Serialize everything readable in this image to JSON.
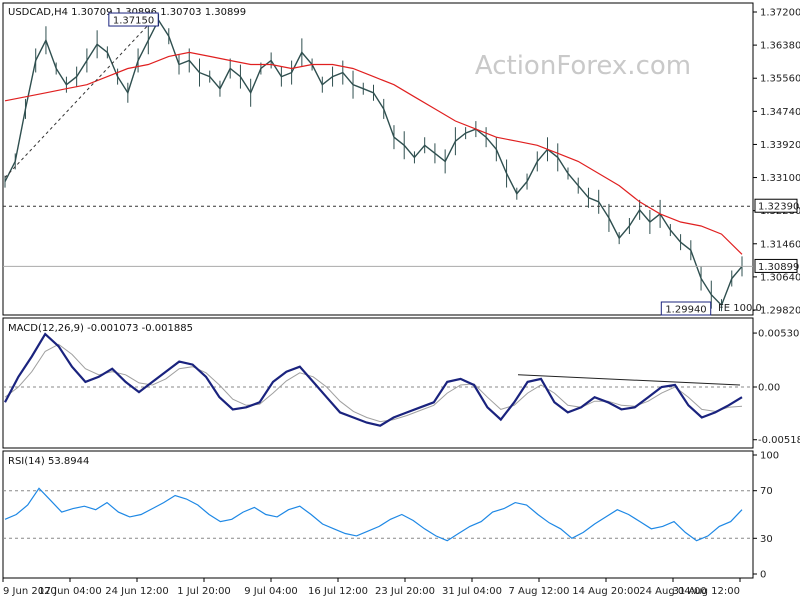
{
  "chart_data": [
    {
      "type": "ohlc",
      "title": "USDCAD,H4  1.30709 1.30896 1.30703 1.30899",
      "watermark": "ActionForex.com",
      "ylim": [
        1.2982,
        1.372
      ],
      "yticks": [
        "1.37200",
        "1.36380",
        "1.35560",
        "1.34740",
        "1.33920",
        "1.33100",
        "1.32280",
        "1.31460",
        "1.30640",
        "1.29820"
      ],
      "yticks_val": [
        1.372,
        1.3638,
        1.3556,
        1.3474,
        1.3392,
        1.331,
        1.3228,
        1.3146,
        1.3064,
        1.2982
      ],
      "price_series": [
        1.33,
        1.335,
        1.348,
        1.36,
        1.365,
        1.358,
        1.354,
        1.356,
        1.36,
        1.364,
        1.362,
        1.356,
        1.352,
        1.36,
        1.365,
        1.37,
        1.366,
        1.359,
        1.36,
        1.357,
        1.356,
        1.353,
        1.358,
        1.356,
        1.352,
        1.358,
        1.36,
        1.356,
        1.357,
        1.362,
        1.359,
        1.354,
        1.356,
        1.357,
        1.354,
        1.353,
        1.352,
        1.348,
        1.341,
        1.339,
        1.336,
        1.339,
        1.337,
        1.335,
        1.34,
        1.342,
        1.343,
        1.341,
        1.338,
        1.332,
        1.327,
        1.33,
        1.335,
        1.338,
        1.336,
        1.332,
        1.329,
        1.326,
        1.325,
        1.321,
        1.316,
        1.319,
        1.323,
        1.32,
        1.322,
        1.318,
        1.315,
        1.313,
        1.306,
        1.302,
        1.2994,
        1.306,
        1.309
      ],
      "ma_series": [
        1.35,
        1.351,
        1.352,
        1.353,
        1.354,
        1.356,
        1.358,
        1.359,
        1.361,
        1.362,
        1.361,
        1.36,
        1.359,
        1.359,
        1.358,
        1.359,
        1.359,
        1.358,
        1.356,
        1.354,
        1.351,
        1.348,
        1.345,
        1.343,
        1.341,
        1.34,
        1.339,
        1.337,
        1.335,
        1.332,
        1.329,
        1.325,
        1.322,
        1.32,
        1.319,
        1.317,
        1.312
      ],
      "hline_values": [
        1.3239,
        1.30899
      ],
      "annotations": [
        {
          "text": "1.37150",
          "value": 1.3715
        },
        {
          "text": "1.29940",
          "value": 1.2994
        },
        {
          "text": "FE 100.0",
          "value": 1.2994
        }
      ],
      "price_labels": [
        {
          "text": "1.32390",
          "value": 1.3239
        },
        {
          "text": "1.30899",
          "value": 1.30899
        }
      ]
    },
    {
      "type": "line",
      "title": "MACD(12,26,9) -0.001073 -0.001885",
      "ylim": [
        -0.0058,
        0.0058
      ],
      "yticks": [
        "0.005302",
        "0.00",
        "-0.005184"
      ],
      "yticks_val": [
        0.005302,
        0.0,
        -0.005184
      ],
      "series": [
        {
          "values": [
            -0.0015,
            0.001,
            0.003,
            0.0052,
            0.004,
            0.002,
            0.0005,
            0.001,
            0.0018,
            0.0005,
            -0.0005,
            0.0005,
            0.0015,
            0.0025,
            0.0022,
            0.001,
            -0.001,
            -0.0022,
            -0.002,
            -0.0015,
            0.0005,
            0.0015,
            0.002,
            0.0005,
            -0.001,
            -0.0025,
            -0.003,
            -0.0035,
            -0.0038,
            -0.003,
            -0.0025,
            -0.002,
            -0.0015,
            0.0005,
            0.0008,
            0.0002,
            -0.002,
            -0.0032,
            -0.0015,
            0.0005,
            0.0008,
            -0.0015,
            -0.0025,
            -0.002,
            -0.001,
            -0.0015,
            -0.0022,
            -0.002,
            -0.001,
            0.0,
            0.0002,
            -0.0018,
            -0.003,
            -0.0025,
            -0.0018,
            -0.001
          ]
        },
        {
          "values": [
            -0.001,
            0.0,
            0.0015,
            0.0035,
            0.0042,
            0.0032,
            0.0018,
            0.0012,
            0.0015,
            0.0012,
            0.0004,
            0.0002,
            0.0008,
            0.0018,
            0.002,
            0.0014,
            0.0002,
            -0.0012,
            -0.0018,
            -0.0017,
            -0.0006,
            0.0006,
            0.0014,
            0.001,
            0.0,
            -0.0014,
            -0.0024,
            -0.003,
            -0.0034,
            -0.0032,
            -0.0028,
            -0.0023,
            -0.0018,
            -0.0006,
            0.0002,
            0.0003,
            -0.001,
            -0.0022,
            -0.0018,
            -0.0006,
            0.0002,
            -0.0006,
            -0.0018,
            -0.002,
            -0.0014,
            -0.0014,
            -0.0018,
            -0.0019,
            -0.0014,
            -0.0006,
            0.0,
            -0.001,
            -0.0022,
            -0.0024,
            -0.002,
            -0.0019
          ]
        }
      ],
      "trendline_values": [
        0.0012,
        0.0002
      ]
    },
    {
      "type": "line",
      "title": "RSI(14) 53.8944",
      "ylim": [
        0,
        100
      ],
      "yticks": [
        "100",
        "70",
        "30",
        "0"
      ],
      "yticks_val": [
        100,
        70,
        30,
        0
      ],
      "series": [
        {
          "values": [
            46,
            50,
            58,
            72,
            62,
            52,
            55,
            57,
            54,
            60,
            52,
            48,
            50,
            55,
            60,
            66,
            63,
            58,
            50,
            44,
            46,
            52,
            56,
            50,
            48,
            54,
            57,
            50,
            42,
            38,
            34,
            32,
            36,
            40,
            46,
            50,
            45,
            38,
            32,
            28,
            34,
            40,
            44,
            52,
            55,
            60,
            58,
            50,
            43,
            38,
            30,
            35,
            42,
            48,
            54,
            50,
            44,
            38,
            40,
            44,
            35,
            28,
            32,
            40,
            44,
            54
          ]
        }
      ]
    }
  ],
  "xticks": [
    "9 Jun 2020",
    "17 Jun 04:00",
    "24 Jun 12:00",
    "1 Jul 20:00",
    "9 Jul 04:00",
    "16 Jul 12:00",
    "23 Jul 20:00",
    "31 Jul 04:00",
    "7 Aug 12:00",
    "14 Aug 20:00",
    "24 Aug 04:00",
    "31 Aug 12:00"
  ],
  "colors": {
    "price": "#2f4f4f",
    "ma": "#e02020",
    "macd": "#1a237e",
    "signal": "#a0a0a0",
    "rsi": "#1e88e5",
    "grid_dash": "#666666",
    "trendline": "#222222",
    "label_box": "#1a237e",
    "watermark": "#c9c9c9"
  }
}
